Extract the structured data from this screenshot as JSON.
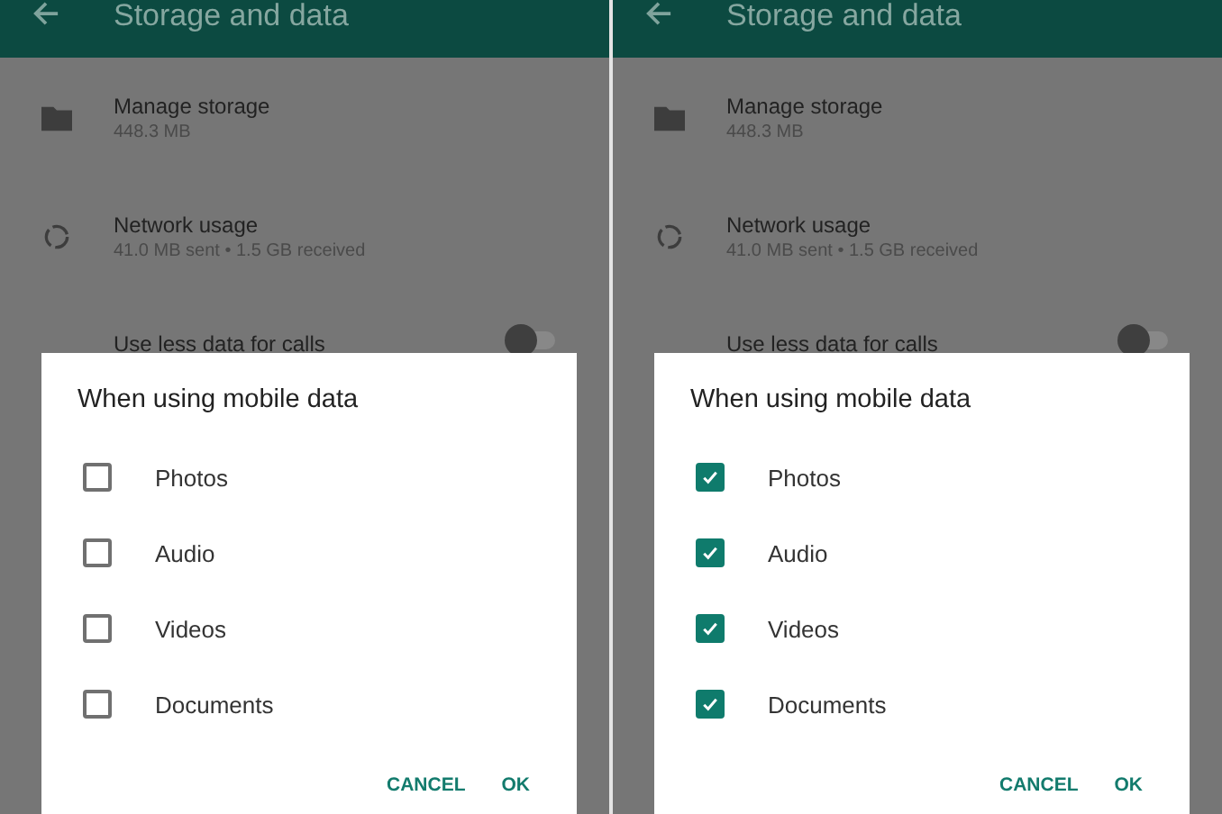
{
  "panels": [
    {
      "header": {
        "title": "Storage and data"
      },
      "items": [
        {
          "kind": "folder",
          "title": "Manage storage",
          "subtitle": "448.3 MB"
        },
        {
          "kind": "network",
          "title": "Network usage",
          "subtitle": "41.0 MB sent • 1.5 GB received"
        },
        {
          "kind": "toggle",
          "title": "Use less data for calls",
          "on": false
        }
      ],
      "dialog": {
        "title": "When using mobile data",
        "options": [
          {
            "label": "Photos",
            "checked": false
          },
          {
            "label": "Audio",
            "checked": false
          },
          {
            "label": "Videos",
            "checked": false
          },
          {
            "label": "Documents",
            "checked": false
          }
        ],
        "buttons": [
          "CANCEL",
          "OK"
        ]
      }
    },
    {
      "header": {
        "title": "Storage and data"
      },
      "items": [
        {
          "kind": "folder",
          "title": "Manage storage",
          "subtitle": "448.3 MB"
        },
        {
          "kind": "network",
          "title": "Network usage",
          "subtitle": "41.0 MB sent • 1.5 GB received"
        },
        {
          "kind": "toggle",
          "title": "Use less data for calls",
          "on": false
        }
      ],
      "dialog": {
        "title": "When using mobile data",
        "options": [
          {
            "label": "Photos",
            "checked": true
          },
          {
            "label": "Audio",
            "checked": true
          },
          {
            "label": "Videos",
            "checked": true
          },
          {
            "label": "Documents",
            "checked": true
          }
        ],
        "buttons": [
          "CANCEL",
          "OK"
        ]
      }
    }
  ]
}
